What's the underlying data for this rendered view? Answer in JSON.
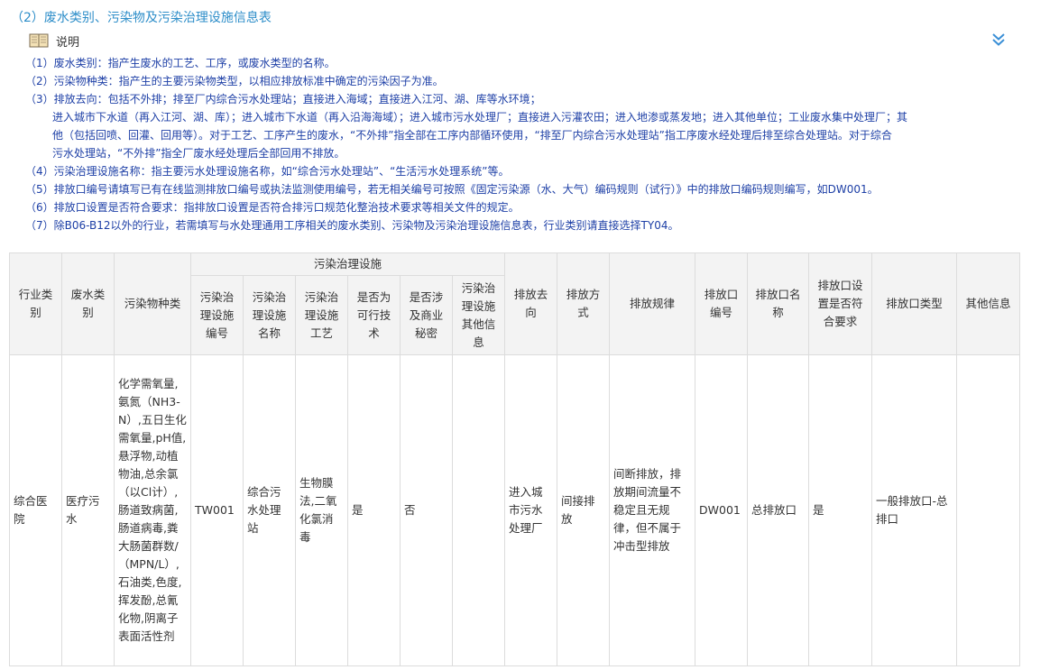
{
  "section_title": "（2）废水类别、污染物及污染治理设施信息表",
  "notes_label": "说明",
  "notes": [
    "（1）废水类别：指产生废水的工艺、工序，或废水类型的名称。",
    "（2）污染物种类：指产生的主要污染物类型，以相应排放标准中确定的污染因子为准。",
    "（3）排放去向：包括不外排；排至厂内综合污水处理站；直接进入海域；直接进入江河、湖、库等水环境；"
  ],
  "note3_cont": [
    "进入城市下水道（再入江河、湖、库）；进入城市下水道（再入沿海海域）；进入城市污水处理厂；直接进入污灌农田；进入地渗或蒸发地；进入其他单位；工业废水集中处理厂；其",
    "他（包括回喷、回灌、回用等）。对于工艺、工序产生的废水，“不外排”指全部在工序内部循环使用，“排至厂内综合污水处理站”指工序废水经处理后排至综合处理站。对于综合",
    "污水处理站，“不外排”指全厂废水经处理后全部回用不排放。"
  ],
  "notes_tail": [
    "（4）污染治理设施名称：指主要污水处理设施名称，如“综合污水处理站”、“生活污水处理系统”等。",
    "（5）排放口编号请填写已有在线监测排放口编号或执法监测使用编号，若无相关编号可按照《固定污染源（水、大气）编码规则（试行）》中的排放口编码规则编写，如DW001。",
    "（6）排放口设置是否符合要求：指排放口设置是否符合排污口规范化整治技术要求等相关文件的规定。",
    "（7）除B06-B12以外的行业，若需填写与水处理通用工序相关的废水类别、污染物及污染治理设施信息表，行业类别请直接选择TY04。"
  ],
  "table": {
    "group_header": "污染治理设施",
    "headers": {
      "industry": "行业类别",
      "wastewater_type": "废水类别",
      "pollutants": "污染物种类",
      "facility_id": "污染治理设施编号",
      "facility_name": "污染治理设施名称",
      "facility_process": "污染治理设施工艺",
      "feasible": "是否为可行技术",
      "secret": "是否涉及商业秘密",
      "facility_other": "污染治理设施其他信息",
      "destination": "排放去向",
      "method": "排放方式",
      "pattern": "排放规律",
      "outlet_id": "排放口编号",
      "outlet_name": "排放口名称",
      "outlet_compliant": "排放口设置是否符合要求",
      "outlet_type": "排放口类型",
      "other_info": "其他信息"
    },
    "rows": [
      {
        "industry": "综合医院",
        "wastewater_type": "医疗污水",
        "pollutants": "化学需氧量,氨氮（NH3-N）,五日生化需氧量,pH值,悬浮物,动植物油,总余氯（以Cl计）,肠道致病菌,肠道病毒,粪大肠菌群数/（MPN/L）,石油类,色度,挥发酚,总氰化物,阴离子表面活性剂",
        "facility_id": "TW001",
        "facility_name": "综合污水处理站",
        "facility_process": "生物膜法,二氧化氯消毒",
        "feasible": "是",
        "secret": "否",
        "facility_other": "",
        "destination": "进入城市污水处理厂",
        "method": "间接排放",
        "pattern": "间断排放，排放期间流量不稳定且无规律，但不属于冲击型排放",
        "outlet_id": "DW001",
        "outlet_name": "总排放口",
        "outlet_compliant": "是",
        "outlet_type": "一般排放口-总排口",
        "other_info": ""
      }
    ]
  }
}
